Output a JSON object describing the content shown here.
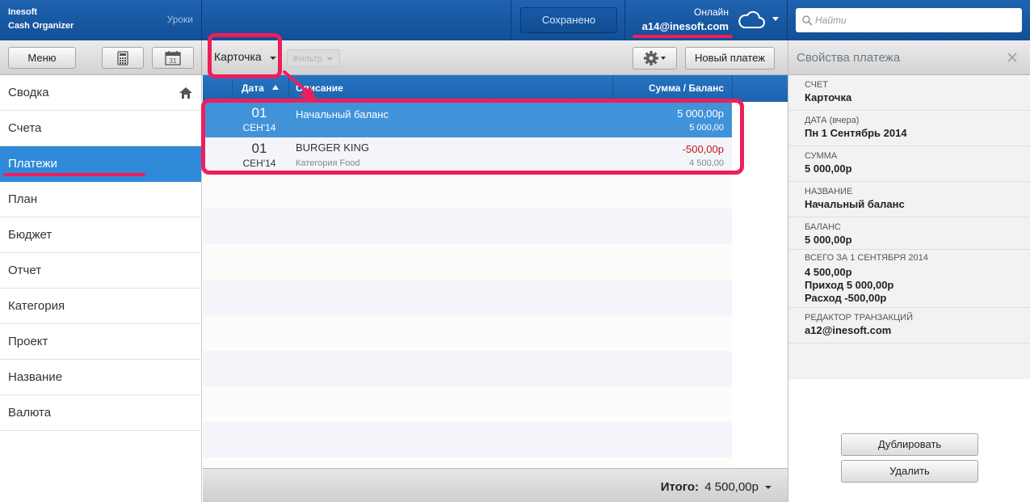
{
  "brand": {
    "line1": "Inesoft",
    "line2": "Cash Organizer",
    "lessons_label": "Уроки"
  },
  "status": {
    "saved_label": "Сохранено",
    "online_label": "Онлайн",
    "email": "a14@inesoft.com",
    "cloud_icon": "cloud-icon"
  },
  "search": {
    "placeholder": "Найти",
    "icon": "search-icon"
  },
  "toolbar": {
    "menu_label": "Меню",
    "calc_icon": "calculator-icon",
    "calendar_icon": "calendar-icon",
    "calendar_day": "31",
    "account_label": "Карточка",
    "filter_label": "Фильтр",
    "gear_icon": "gear-icon",
    "new_payment_label": "Новый платеж"
  },
  "sidebar": {
    "items": [
      {
        "label": "Сводка",
        "icon": "home-icon"
      },
      {
        "label": "Счета"
      },
      {
        "label": "Платежи",
        "active": true
      },
      {
        "label": "План"
      },
      {
        "label": "Бюджет"
      },
      {
        "label": "Отчет"
      },
      {
        "label": "Категория"
      },
      {
        "label": "Проект"
      },
      {
        "label": "Название"
      },
      {
        "label": "Валюта"
      }
    ]
  },
  "table": {
    "headers": {
      "date": "Дата",
      "description": "Описание",
      "amount": "Сумма / Баланс"
    },
    "rows": [
      {
        "day": "01",
        "month": "СЕН'14",
        "description": "Начальный баланс",
        "category": "",
        "amount": "5 000,00р",
        "balance": "5 000,00",
        "selected": true
      },
      {
        "day": "01",
        "month": "СЕН'14",
        "description": "BURGER KING",
        "category": "Категория Food",
        "amount": "-500,00р",
        "balance": "4 500,00",
        "negative": true
      }
    ]
  },
  "footer": {
    "total_label": "Итого:",
    "total_value": "4 500,00р"
  },
  "properties": {
    "title": "Свойства платежа",
    "close_icon": "close-icon",
    "fields": [
      {
        "label": "Счет",
        "value": "Карточка"
      },
      {
        "label": "ДАТА (вчера)",
        "value": "Пн 1 Сентябрь 2014"
      },
      {
        "label": "Сумма",
        "value": "5 000,00р"
      },
      {
        "label": "Название",
        "value": "Начальный баланс"
      },
      {
        "label": "Баланс",
        "value": "5 000,00р"
      },
      {
        "label": "Всего за 1 сентября 2014",
        "value_lines": [
          "4 500,00р",
          "Приход 5 000,00р",
          "Расход -500,00р"
        ]
      },
      {
        "label": "Редактор транзакций",
        "value": "a12@inesoft.com"
      }
    ],
    "duplicate_label": "Дублировать",
    "delete_label": "Удалить"
  },
  "colors": {
    "accent_blue": "#2e8ad8",
    "highlight_pink": "#ee1e5b",
    "negative_red": "#c11b14"
  }
}
